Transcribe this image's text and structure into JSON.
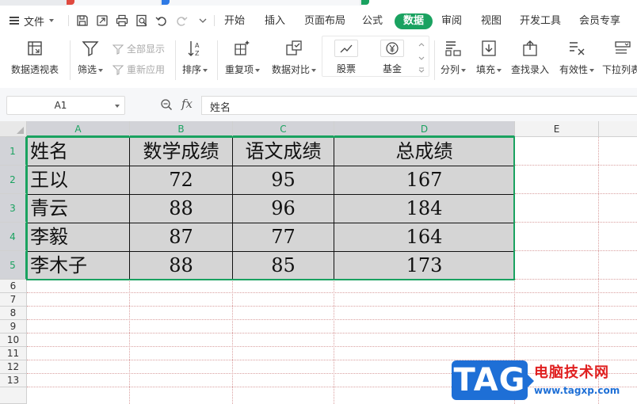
{
  "menu": {
    "file_label": "文件",
    "tabs": [
      {
        "label": "开始"
      },
      {
        "label": "插入"
      },
      {
        "label": "页面布局"
      },
      {
        "label": "公式"
      },
      {
        "label": "数据",
        "active": true
      },
      {
        "label": "审阅"
      },
      {
        "label": "视图"
      },
      {
        "label": "开发工具"
      },
      {
        "label": "会员专享"
      }
    ]
  },
  "ribbon": {
    "pivot_table": "数据透视表",
    "filter": "筛选",
    "show_all": "全部显示",
    "reapply": "重新应用",
    "sort": "排序",
    "duplicates": "重复项",
    "compare": "数据对比",
    "stocks": "股票",
    "funds": "基金",
    "split_column": "分列",
    "fill": "填充",
    "lookup_entry": "查找录入",
    "validity": "有效性",
    "dropdown_list": "下拉列表"
  },
  "formula_bar": {
    "name_box": "A1",
    "fx": "fx",
    "content": "姓名"
  },
  "sheet": {
    "columns": [
      "A",
      "B",
      "C",
      "D",
      "E"
    ],
    "rows": [
      "1",
      "2",
      "3",
      "4",
      "5",
      "6",
      "7",
      "8",
      "9",
      "10",
      "11",
      "12",
      "13"
    ],
    "table": [
      [
        "姓名",
        "数学成绩",
        "语文成绩",
        "总成绩"
      ],
      [
        "王以",
        "72",
        "95",
        "167"
      ],
      [
        "青云",
        "88",
        "96",
        "184"
      ],
      [
        "李毅",
        "87",
        "77",
        "164"
      ],
      [
        "李木子",
        "88",
        "85",
        "173"
      ]
    ]
  },
  "colors": {
    "accent": "#1aa260",
    "selection_fill": "#d5d5d5",
    "gridline": "#d9a0a0"
  },
  "watermark": {
    "logo": "TAG",
    "site": "电脑技术网",
    "url": "www.tagxp.com"
  }
}
